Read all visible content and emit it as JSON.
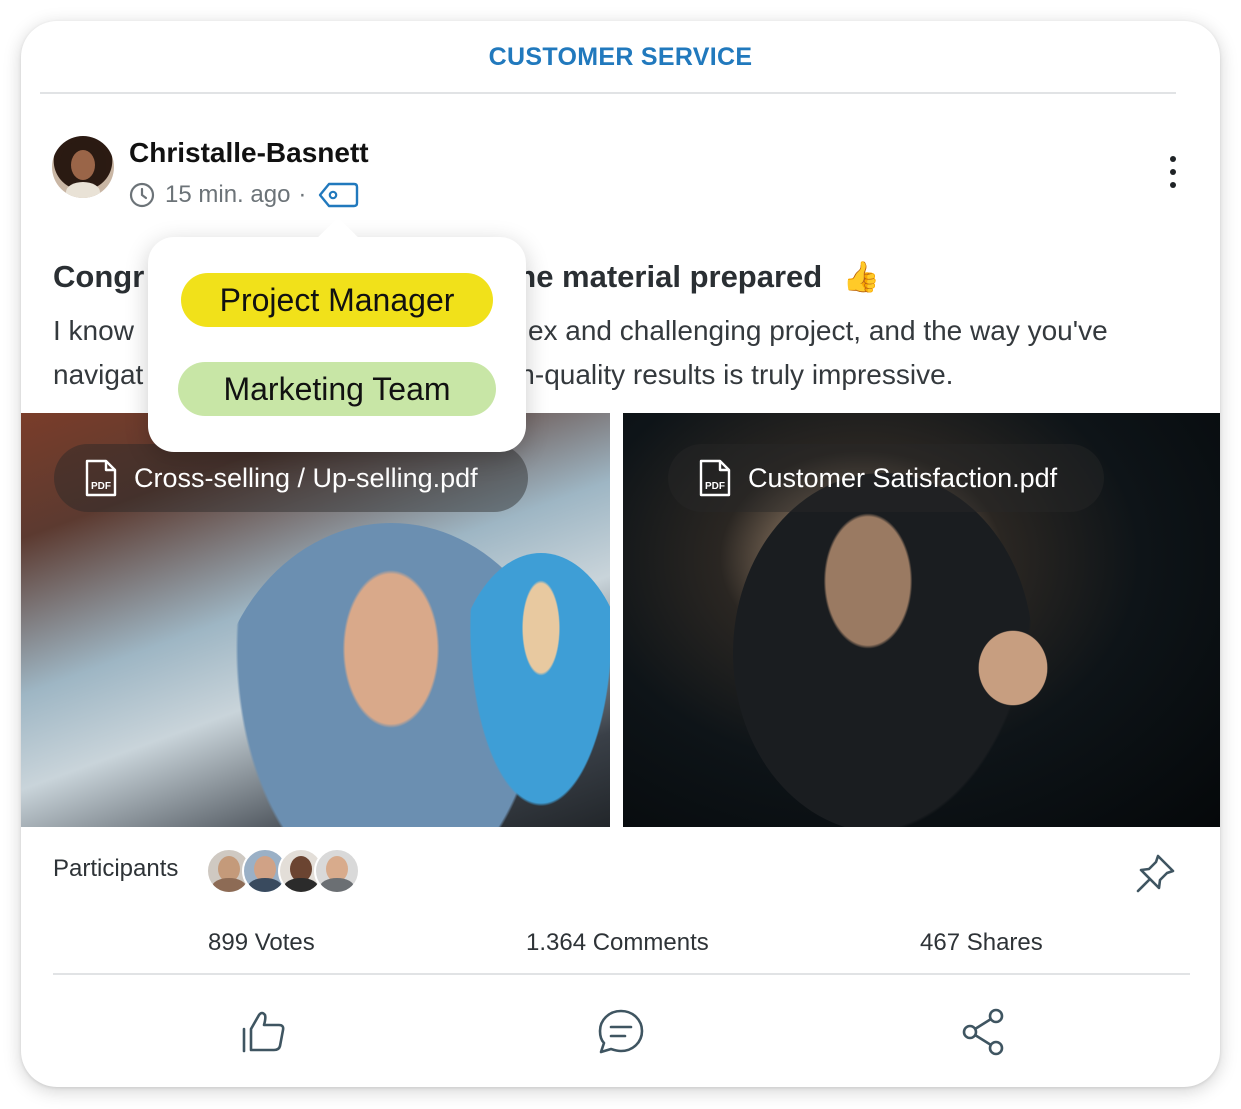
{
  "header": {
    "title": "CUSTOMER SERVICE"
  },
  "post": {
    "author": "Christalle-Basnett",
    "time": "15 min. ago",
    "separator": "·",
    "headline_start": "Congr",
    "headline_end": "r the material prepared",
    "body_line1_start": "I know",
    "body_line1_end": "ex and challenging project, and the way you've",
    "body_line2_start": "navigat",
    "body_line2_end": "n-quality results is truly impressive."
  },
  "tags_popover": {
    "tags": [
      {
        "label": "Project Manager",
        "color": "#f1e11a"
      },
      {
        "label": "Marketing Team",
        "color": "#c8e6a6"
      }
    ]
  },
  "attachments": [
    {
      "name": "Cross-selling / Up-selling.pdf",
      "icon": "pdf-icon"
    },
    {
      "name": "Customer Satisfaction.pdf",
      "icon": "pdf-icon"
    }
  ],
  "participants": {
    "label": "Participants",
    "count_avatars": 4
  },
  "stats": {
    "votes": "899 Votes",
    "comments": "1.364 Comments",
    "shares": "467 Shares"
  },
  "colors": {
    "accent": "#2179bd",
    "icon": "#3f5561"
  }
}
